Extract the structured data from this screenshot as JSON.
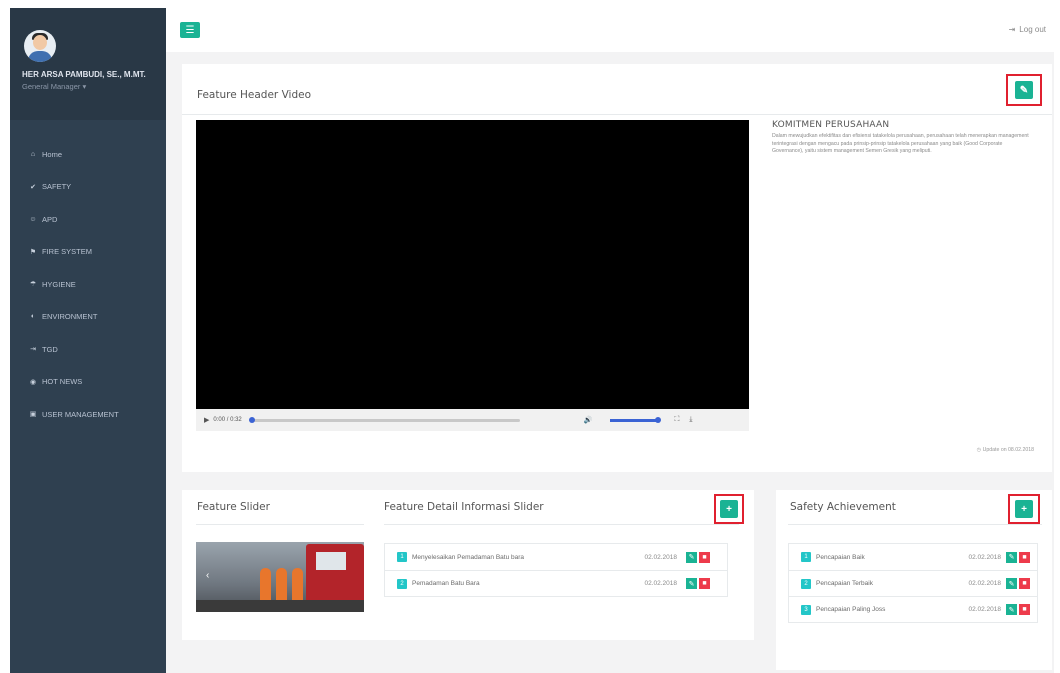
{
  "colors": {
    "sidebar": "#2f4050",
    "accent": "#1ab394",
    "danger": "#ed3b4b",
    "badge": "#23c6c8",
    "highlight": "#e0202f"
  },
  "user": {
    "name": "HER ARSA PAMBUDI, SE., M.MT.",
    "role": "General Manager ▾"
  },
  "sidebar": {
    "items": [
      {
        "icon": "home-icon",
        "glyph": "⌂",
        "label": "Home"
      },
      {
        "icon": "thumbs-up-icon",
        "glyph": "✔",
        "label": "SAFETY"
      },
      {
        "icon": "user-icon",
        "glyph": "☺",
        "label": "APD"
      },
      {
        "icon": "fire-extinguisher-icon",
        "glyph": "⚑",
        "label": "FIRE SYSTEM"
      },
      {
        "icon": "umbrella-icon",
        "glyph": "☂",
        "label": "HYGIENE"
      },
      {
        "icon": "globe-icon",
        "glyph": "◐",
        "label": "ENVIRONMENT"
      },
      {
        "icon": "sign-in-icon",
        "glyph": "⇥",
        "label": "TGD"
      },
      {
        "icon": "globe-news-icon",
        "glyph": "◉",
        "label": "HOT NEWS"
      },
      {
        "icon": "lock-icon",
        "glyph": "▣",
        "label": "USER MANAGEMENT"
      }
    ]
  },
  "topbar": {
    "logout_label": "Log out"
  },
  "video_box": {
    "title": "Feature Header Video",
    "player": {
      "time": "0:00 / 0:32",
      "progress": 0.0,
      "volume": 1.0
    },
    "commitment": {
      "title": "KOMITMEN PERUSAHAAN",
      "body": "Dalam mewujudkan efektifitas dan efisiensi tatakelola perusahaan, perusahaan telah menerapkan management terintegrasi dengan mengacu pada prinsip-prinsip tatakelola perusahaan yang baik (Good Corporate Governance), yaitu sistem management Semen Gresik yang meliputi."
    },
    "updated": "Update on 08.02.2018"
  },
  "slider_box": {
    "title": "Feature Slider",
    "detail_title": "Feature Detail Informasi Slider",
    "items": [
      {
        "no": "1",
        "label": "Menyelesaikan Pemadaman Batu bara",
        "date": "02.02.2018"
      },
      {
        "no": "2",
        "label": "Pemadaman Batu Bara",
        "date": "02.02.2018"
      }
    ]
  },
  "safety_box": {
    "title": "Safety Achievement",
    "items": [
      {
        "no": "1",
        "label": "Pencapaian Baik",
        "date": "02.02.2018"
      },
      {
        "no": "2",
        "label": "Pencapaian Terbaik",
        "date": "02.02.2018"
      },
      {
        "no": "3",
        "label": "Pencapaian Paling Joss",
        "date": "02.02.2018"
      }
    ]
  }
}
